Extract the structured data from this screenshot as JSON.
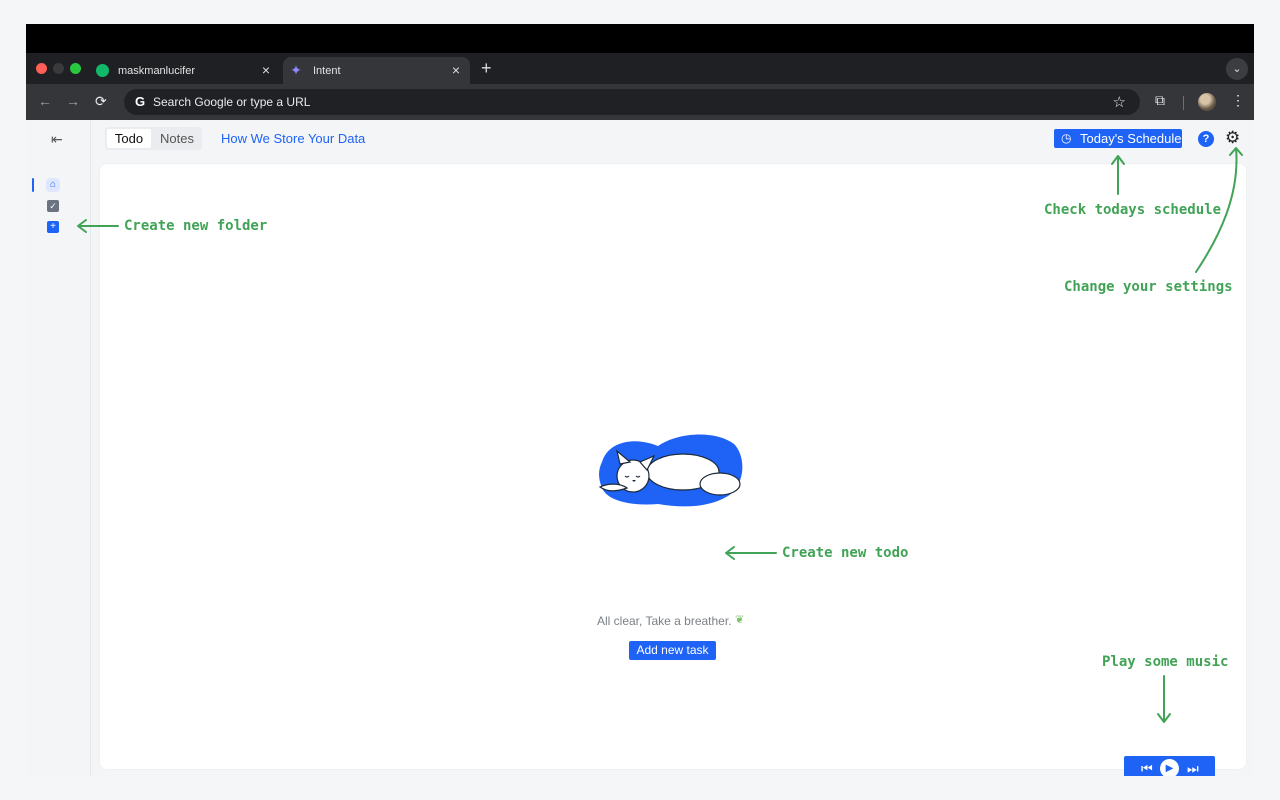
{
  "browser": {
    "tabs": [
      {
        "label": "maskmanlucifer",
        "icon": "green-circle-icon"
      },
      {
        "label": "Intent",
        "icon": "intent-logo-icon"
      }
    ],
    "newtab": "+",
    "omnibox_placeholder": "Search Google or type a URL"
  },
  "header": {
    "segment": {
      "todo": "Todo",
      "notes": "Notes"
    },
    "link": "How We Store Your Data",
    "schedule_button": "Today's Schedule",
    "help": "?"
  },
  "main": {
    "empty_text": "All clear, Take a breather.",
    "add_button": "Add new task"
  },
  "annotations": {
    "folder": "Create new folder",
    "schedule": "Check todays schedule",
    "settings": "Change your settings",
    "todo": "Create new todo",
    "music": "Play some music"
  },
  "colors": {
    "accent": "#1E63F5",
    "annotation": "#41A356",
    "browser_chrome": "#35363A"
  }
}
